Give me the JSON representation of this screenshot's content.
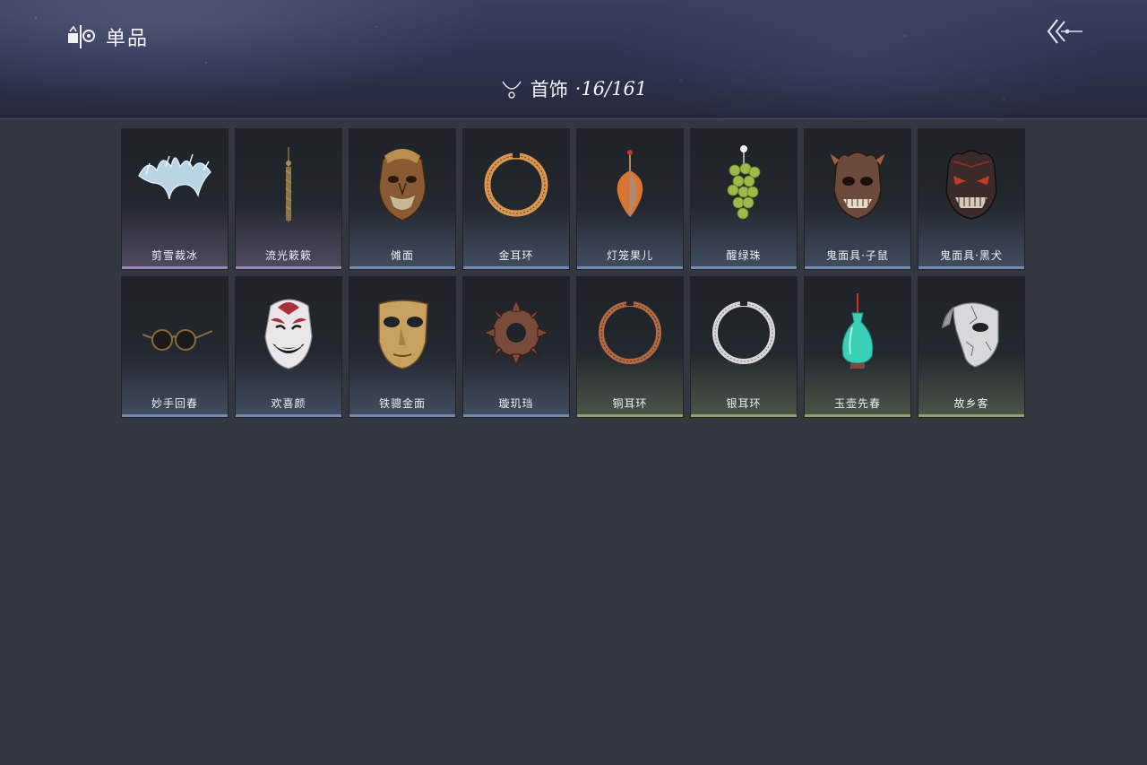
{
  "header": {
    "title": "单品",
    "logo_icon": "collection-logo-icon",
    "back_icon": "double-chevron-back-icon"
  },
  "category": {
    "icon": "necklace-icon",
    "name": "首饰",
    "count": "·16/161"
  },
  "rarity_colors": {
    "purple": "#9b86b8",
    "blue": "#6f8cb6",
    "green": "#8ea56a"
  },
  "items": [
    {
      "name": "剪雪裁冰",
      "icon": "ice-crown-icon",
      "rarity": "purple"
    },
    {
      "name": "流光簌簌",
      "icon": "hairpin-tassel-icon",
      "rarity": "purple"
    },
    {
      "name": "傩面",
      "icon": "nuo-mask-icon",
      "rarity": "blue"
    },
    {
      "name": "金耳环",
      "icon": "gold-earring-icon",
      "rarity": "blue"
    },
    {
      "name": "灯笼果儿",
      "icon": "lantern-fruit-icon",
      "rarity": "blue"
    },
    {
      "name": "醒绿珠",
      "icon": "green-grape-beads-icon",
      "rarity": "blue"
    },
    {
      "name": "鬼面具·子鼠",
      "icon": "rat-ghost-mask-icon",
      "rarity": "blue"
    },
    {
      "name": "鬼面具·黑犬",
      "icon": "dog-ghost-mask-icon",
      "rarity": "blue"
    },
    {
      "name": "妙手回春",
      "icon": "round-glasses-icon",
      "rarity": "blue"
    },
    {
      "name": "欢喜颜",
      "icon": "smiling-mask-icon",
      "rarity": "blue"
    },
    {
      "name": "铁骢金面",
      "icon": "golden-half-mask-icon",
      "rarity": "blue"
    },
    {
      "name": "璇玑珰",
      "icon": "cog-ring-icon",
      "rarity": "blue"
    },
    {
      "name": "铜耳环",
      "icon": "copper-earring-icon",
      "rarity": "green"
    },
    {
      "name": "银耳环",
      "icon": "silver-earring-icon",
      "rarity": "green"
    },
    {
      "name": "玉壶先春",
      "icon": "jade-vase-icon",
      "rarity": "green"
    },
    {
      "name": "故乡客",
      "icon": "cracked-half-mask-icon",
      "rarity": "green"
    }
  ]
}
